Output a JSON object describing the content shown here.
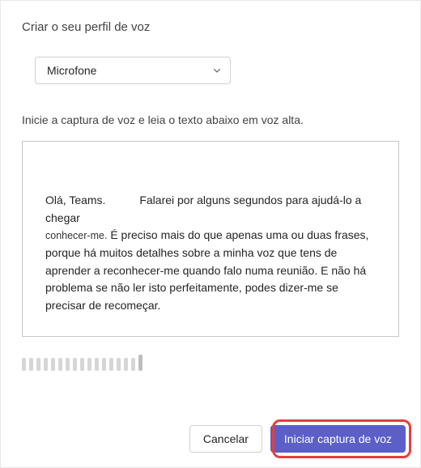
{
  "page_title": "Criar o seu perfil de voz",
  "microphone": {
    "selected": "Microfone"
  },
  "instruction": "Inicie a captura de voz e leia o texto abaixo em voz alta.",
  "script": {
    "greeting": "Olá, Teams.",
    "line1": "Falarei por alguns segundos para ajudá-lo a chegar",
    "line2_small": "conhecer-me.",
    "line2_rest": " É preciso mais do que apenas uma ou duas frases, porque há muitos detalhes sobre a minha voz que tens de aprender a reconhecer-me quando falo numa reunião. E não há problema se não ler isto perfeitamente, podes dizer-me se precisar de recomeçar."
  },
  "buttons": {
    "cancel": "Cancelar",
    "start": "Iniciar captura de voz"
  },
  "colors": {
    "primary": "#5b5fc7",
    "highlight": "#e53e3e"
  }
}
